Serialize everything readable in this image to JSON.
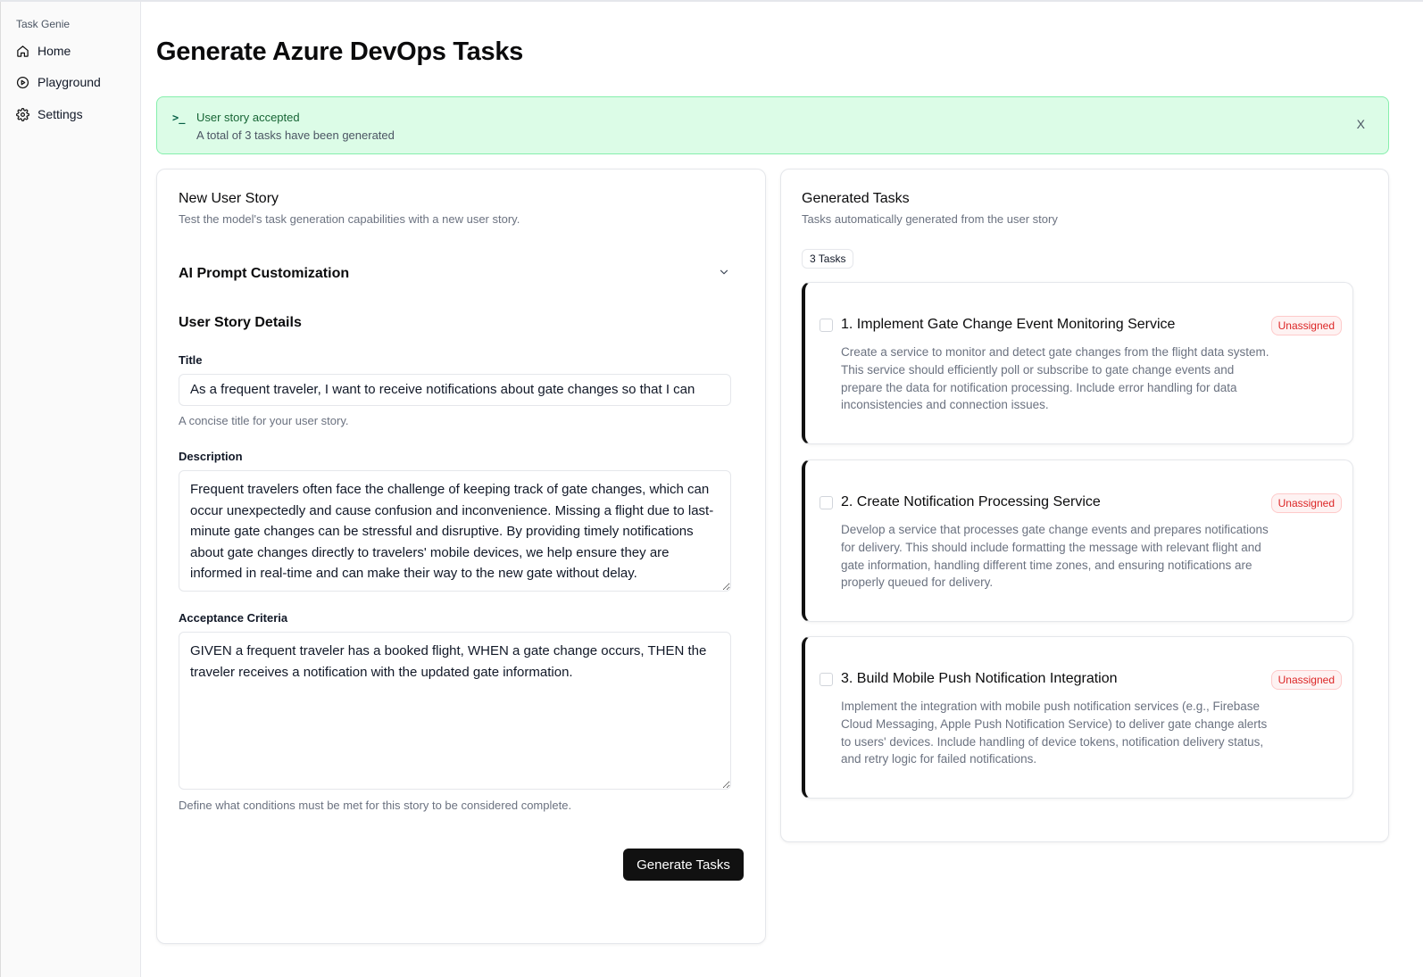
{
  "sidebar": {
    "brand": "Task Genie",
    "items": [
      {
        "label": "Home",
        "icon": "home-icon"
      },
      {
        "label": "Playground",
        "icon": "play-circle-icon"
      },
      {
        "label": "Settings",
        "icon": "gear-icon"
      }
    ]
  },
  "page": {
    "title": "Generate Azure DevOps Tasks"
  },
  "alert": {
    "glyph": ">_",
    "title": "User story accepted",
    "description": "A total of 3 tasks have been generated",
    "close": "X",
    "colors": {
      "background": "#dcfce7",
      "border": "#86efac",
      "title": "#166534"
    }
  },
  "story": {
    "title": "New User Story",
    "subtitle": "Test the model's task generation capabilities with a new user story.",
    "prompt_section": "AI Prompt Customization",
    "details_heading": "User Story Details",
    "title_label": "Title",
    "title_value": "As a frequent traveler, I want to receive notifications about gate changes so that I can",
    "title_helper": "A concise title for your user story.",
    "description_label": "Description",
    "description_value": "Frequent travelers often face the challenge of keeping track of gate changes, which can occur unexpectedly and cause confusion and inconvenience. Missing a flight due to last-minute gate changes can be stressful and disruptive. By providing timely notifications about gate changes directly to travelers' mobile devices, we help ensure they are informed in real-time and can make their way to the new gate without delay.",
    "criteria_label": "Acceptance Criteria",
    "criteria_value": "GIVEN a frequent traveler has a booked flight, WHEN a gate change occurs, THEN the traveler receives a notification with the updated gate information.",
    "criteria_helper": "Define what conditions must be met for this story to be considered complete.",
    "generate_button": "Generate Tasks"
  },
  "tasks_panel": {
    "title": "Generated Tasks",
    "subtitle": "Tasks automatically generated from the user story",
    "count_label": "3 Tasks",
    "tasks": [
      {
        "title": "1. Implement Gate Change Event Monitoring Service",
        "description": "Create a service to monitor and detect gate changes from the flight data system. This service should efficiently poll or subscribe to gate change events and prepare the data for notification processing. Include error handling for data inconsistencies and connection issues.",
        "status": "Unassigned"
      },
      {
        "title": "2. Create Notification Processing Service",
        "description": "Develop a service that processes gate change events and prepares notifications for delivery. This should include formatting the message with relevant flight and gate information, handling different time zones, and ensuring notifications are properly queued for delivery.",
        "status": "Unassigned"
      },
      {
        "title": "3. Build Mobile Push Notification Integration",
        "description": "Implement the integration with mobile push notification services (e.g., Firebase Cloud Messaging, Apple Push Notification Service) to deliver gate change alerts to users' devices. Include handling of device tokens, notification delivery status, and retry logic for failed notifications.",
        "status": "Unassigned"
      }
    ]
  }
}
